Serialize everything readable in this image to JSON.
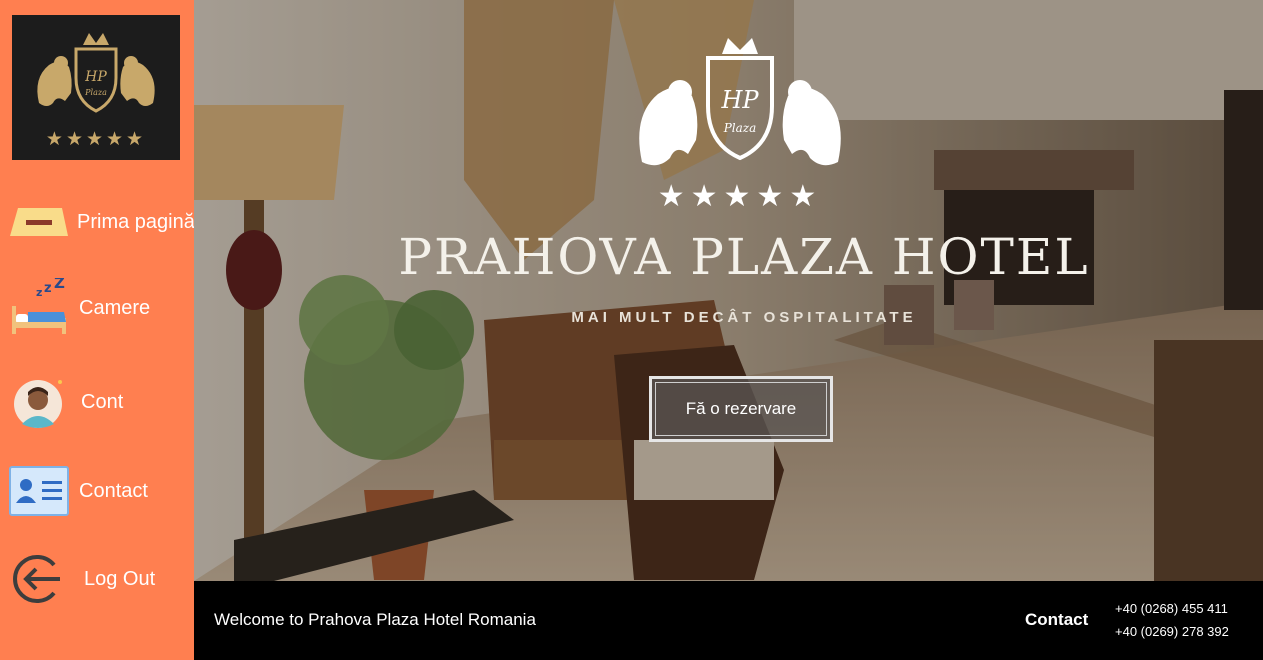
{
  "sidebar": {
    "logo": {
      "icon": "hotel-crest-logo",
      "stars": "★★★★★",
      "monogram": "HP",
      "script": "Plaza"
    },
    "items": [
      {
        "label": "Prima pagină",
        "icon": "home-drawer-icon"
      },
      {
        "label": "Camere",
        "icon": "bed-sleep-icon"
      },
      {
        "label": "Cont",
        "icon": "user-avatar-icon"
      },
      {
        "label": "Contact",
        "icon": "contact-card-icon"
      },
      {
        "label": "Log Out",
        "icon": "logout-arrow-icon"
      }
    ]
  },
  "hero": {
    "title": "PRAHOVA PLAZA HOTEL",
    "subtitle": "MAI MULT DECÂT OSPITALITATE",
    "stars": "★★★★★",
    "monogram": "HP",
    "script": "Plaza",
    "cta_label": "Fă o rezervare"
  },
  "footer": {
    "welcome": "Welcome to Prahova Plaza Hotel Romania",
    "contact_label": "Contact",
    "phones": [
      "+40 (0268) 455 411",
      "+40 (0269) 278 392"
    ]
  },
  "colors": {
    "sidebar": "#ff7f50",
    "footer": "#000000",
    "logo_bg": "#1c1c1c",
    "gold": "#c8a86a"
  }
}
